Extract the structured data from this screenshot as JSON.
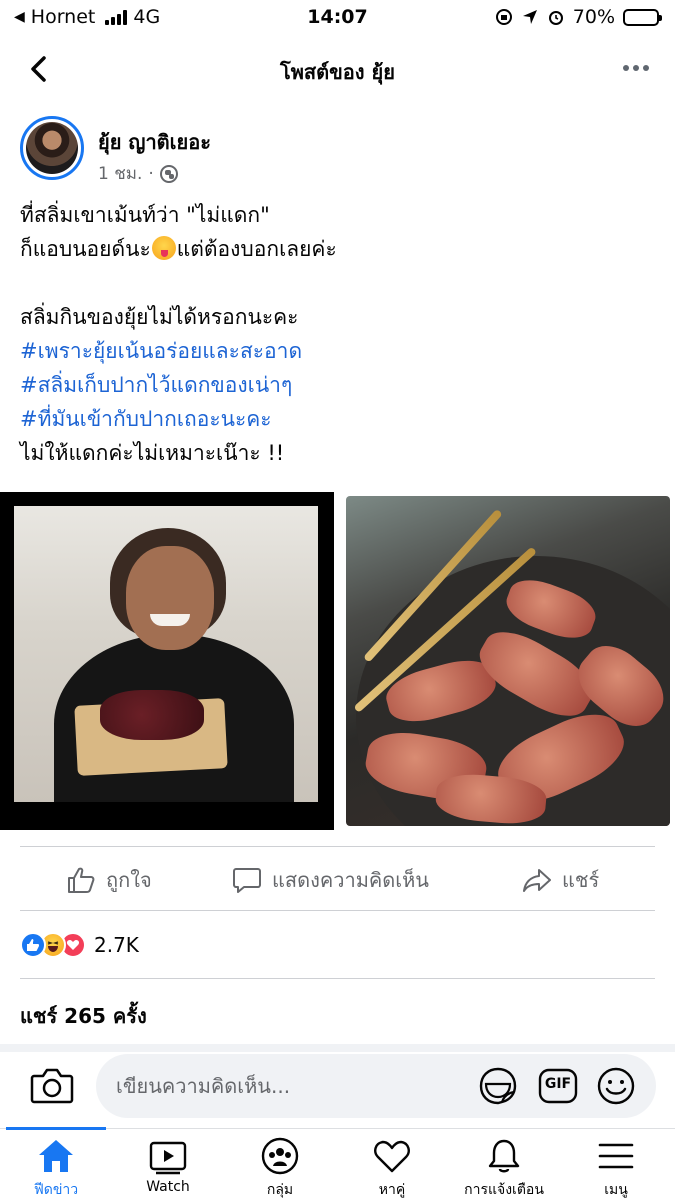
{
  "status_bar": {
    "carrier": "Hornet",
    "network": "4G",
    "time": "14:07",
    "battery": "70%",
    "battery_level": 0.7
  },
  "nav": {
    "title": "โพสต์ของ ยุ้ย",
    "back_icon": "chevron-left-icon",
    "more_icon": "more-horizontal-icon"
  },
  "post": {
    "author": "ยุ้ย ญาติเยอะ",
    "time": "1 ชม.",
    "privacy_icon": "globe-icon",
    "text_lines": [
      "ที่สลิ่มเขาเม้นท์ว่า \"ไม่แดก\"",
      "ก็แอบนอยด์นะ",
      "แต่ต้องบอกเลยค่ะ",
      "สลิ่มกินของยุ้ยไม่ได้หรอกนะคะ",
      "#เพราะยุ้ยเน้นอร่อยและสะอาด",
      "#สลิ่มเก็บปากไว้แดกของเน่าๆ",
      "#ที่มันเข้ากับปากเถอะนะคะ",
      "ไม่ให้แดกค่ะไม่เหมาะเน๊าะ !!"
    ]
  },
  "actions": {
    "like": "ถูกใจ",
    "comment": "แสดงความคิดเห็น",
    "share": "แชร์"
  },
  "reactions": {
    "count": "2.7K",
    "types": [
      "like",
      "haha",
      "love"
    ]
  },
  "shares": {
    "text": "แชร์ 265 ครั้ง"
  },
  "comment_bar": {
    "placeholder": "เขียนความคิดเห็น...",
    "gif_label": "GIF"
  },
  "tabs": [
    {
      "label": "ฟีดข่าว",
      "icon": "home-icon",
      "active": true
    },
    {
      "label": "Watch",
      "icon": "watch-icon",
      "active": false
    },
    {
      "label": "กลุ่ม",
      "icon": "groups-icon",
      "active": false
    },
    {
      "label": "หาคู่",
      "icon": "dating-heart-icon",
      "active": false
    },
    {
      "label": "การแจ้งเตือน",
      "icon": "bell-icon",
      "active": false
    },
    {
      "label": "เมนู",
      "icon": "menu-icon",
      "active": false
    }
  ],
  "colors": {
    "accent": "#1877f2",
    "hashtag": "#1d64d4",
    "secondary_text": "#65676b"
  }
}
